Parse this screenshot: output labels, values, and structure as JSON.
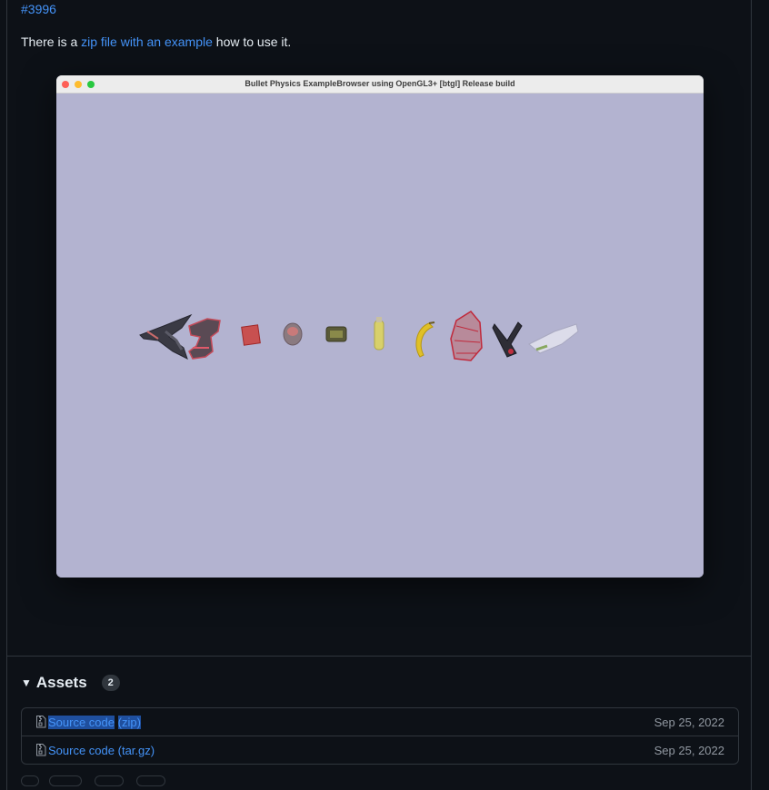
{
  "release": {
    "issue_link": "#3996",
    "para_before": "There is a ",
    "para_link": "zip file with an example",
    "para_after": " how to use it."
  },
  "window": {
    "title": "Bullet Physics ExampleBrowser using OpenGL3+ [btgl] Release build",
    "viewport_color": "#b3b3d0"
  },
  "assets": {
    "title": "Assets",
    "count": "2",
    "items": [
      {
        "name_main": "Source code",
        "name_ext": "(zip)",
        "date": "Sep 25, 2022"
      },
      {
        "name_main": "Source code",
        "name_ext": "(tar.gz)",
        "date": "Sep 25, 2022"
      }
    ]
  },
  "colors": {
    "background": "#0d1117",
    "link": "#4493f8",
    "border": "#30363d",
    "muted": "#9198a1",
    "selection": "#1f4f9e"
  }
}
